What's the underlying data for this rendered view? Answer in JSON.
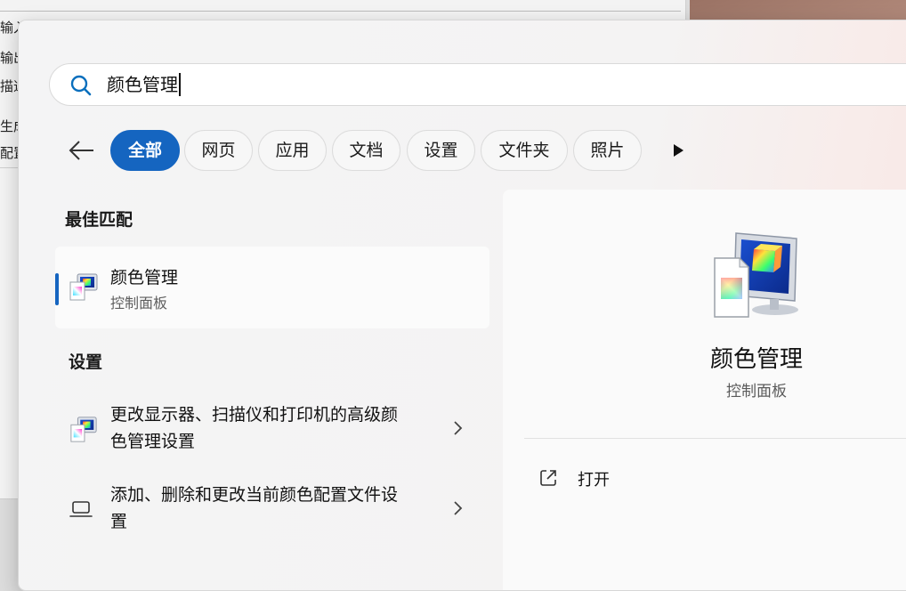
{
  "background_window": {
    "labels": [
      "输入",
      "输出",
      "描述",
      "生成",
      "配置"
    ]
  },
  "search": {
    "query": "颜色管理"
  },
  "filters": [
    {
      "label": "全部",
      "active": true
    },
    {
      "label": "网页",
      "active": false
    },
    {
      "label": "应用",
      "active": false
    },
    {
      "label": "文档",
      "active": false
    },
    {
      "label": "设置",
      "active": false
    },
    {
      "label": "文件夹",
      "active": false
    },
    {
      "label": "照片",
      "active": false
    }
  ],
  "best_match": {
    "section_title": "最佳匹配",
    "title": "颜色管理",
    "subtitle": "控制面板",
    "icon": "color-management-icon"
  },
  "settings_section": {
    "title": "设置",
    "items": [
      {
        "label": "更改显示器、扫描仪和打印机的高级颜色管理设置",
        "icon": "color-management-icon"
      },
      {
        "label": "添加、删除和更改当前颜色配置文件设置",
        "icon": "laptop-icon"
      }
    ]
  },
  "preview": {
    "title": "颜色管理",
    "subtitle": "控制面板",
    "actions": [
      {
        "label": "打开",
        "icon": "open-external-icon"
      }
    ]
  },
  "colors": {
    "accent": "#1565c0",
    "panel_background": "#f4f4f5"
  }
}
